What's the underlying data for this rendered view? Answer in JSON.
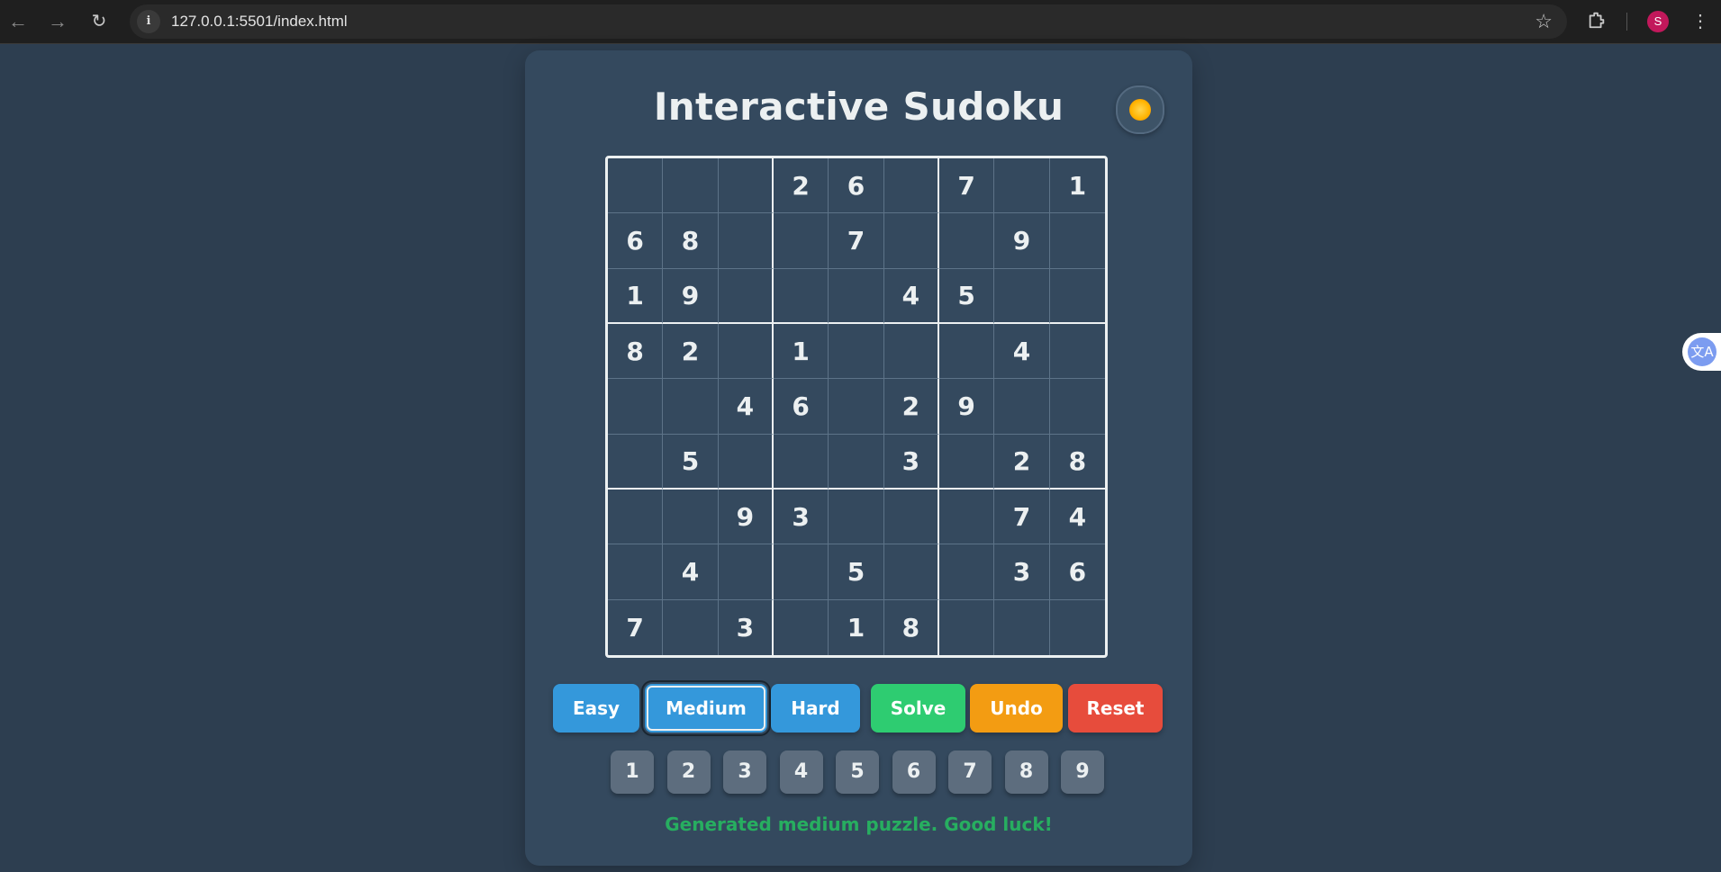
{
  "browser": {
    "url": "127.0.0.1:5501/index.html",
    "avatar_initial": "S",
    "translate_label": "文A"
  },
  "app": {
    "title": "Interactive Sudoku",
    "theme_icon": "sun-icon"
  },
  "board": {
    "rows": [
      [
        "",
        "",
        "",
        "2",
        "6",
        "",
        "7",
        "",
        "1"
      ],
      [
        "6",
        "8",
        "",
        "",
        "7",
        "",
        "",
        "9",
        ""
      ],
      [
        "1",
        "9",
        "",
        "",
        "",
        "4",
        "5",
        "",
        ""
      ],
      [
        "8",
        "2",
        "",
        "1",
        "",
        "",
        "",
        "4",
        ""
      ],
      [
        "",
        "",
        "4",
        "6",
        "",
        "2",
        "9",
        "",
        ""
      ],
      [
        "",
        "5",
        "",
        "",
        "",
        "3",
        "",
        "2",
        "8"
      ],
      [
        "",
        "",
        "9",
        "3",
        "",
        "",
        "",
        "7",
        "4"
      ],
      [
        "",
        "4",
        "",
        "",
        "5",
        "",
        "",
        "3",
        "6"
      ],
      [
        "7",
        "",
        "3",
        "",
        "1",
        "8",
        "",
        "",
        ""
      ]
    ]
  },
  "controls": {
    "easy": "Easy",
    "medium": "Medium",
    "hard": "Hard",
    "solve": "Solve",
    "undo": "Undo",
    "reset": "Reset",
    "selected_difficulty": "Medium"
  },
  "numpad": [
    "1",
    "2",
    "3",
    "4",
    "5",
    "6",
    "7",
    "8",
    "9"
  ],
  "status": "Generated medium puzzle. Good luck!",
  "colors": {
    "background": "#2d3e50",
    "card": "#34495e",
    "blue": "#3498db",
    "green": "#2ecc71",
    "orange": "#f39c12",
    "red": "#e74c3c",
    "status": "#27ae60"
  }
}
